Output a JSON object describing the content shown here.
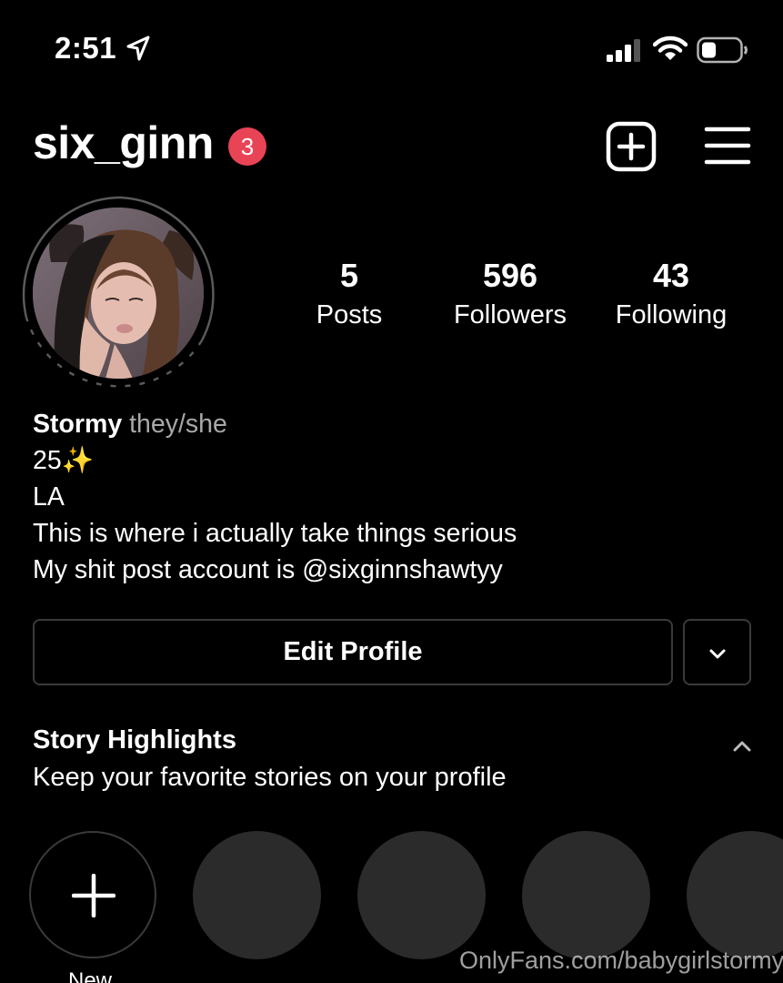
{
  "status_bar": {
    "time": "2:51",
    "location_icon": "location-arrow-icon",
    "signal_icon": "cell-signal-icon",
    "wifi_icon": "wifi-icon",
    "battery_icon": "battery-icon"
  },
  "header": {
    "username": "six_ginn",
    "notification_count": "3",
    "create_icon": "plus-square-icon",
    "menu_icon": "hamburger-menu-icon"
  },
  "stats": {
    "posts": {
      "value": "5",
      "label": "Posts"
    },
    "followers": {
      "value": "596",
      "label": "Followers"
    },
    "following": {
      "value": "43",
      "label": "Following"
    }
  },
  "bio": {
    "name": "Stormy",
    "pronouns": "they/she",
    "lines": [
      "25✨",
      "LA",
      "This is where i actually take things serious",
      "My shit post account is @sixginnshawtyy"
    ]
  },
  "actions": {
    "edit_profile": "Edit Profile",
    "more_icon": "chevron-down-icon"
  },
  "story_highlights": {
    "title": "Story Highlights",
    "subtitle": "Keep your favorite stories on your profile",
    "collapse_icon": "chevron-up-icon",
    "new_label": "New"
  },
  "watermark": "OnlyFans.com/babygirlstormy",
  "colors": {
    "background": "#000000",
    "badge": "#e94356",
    "border": "#3a3a3a",
    "placeholder": "#2b2b2b",
    "secondary_text": "#a8a8a8"
  }
}
